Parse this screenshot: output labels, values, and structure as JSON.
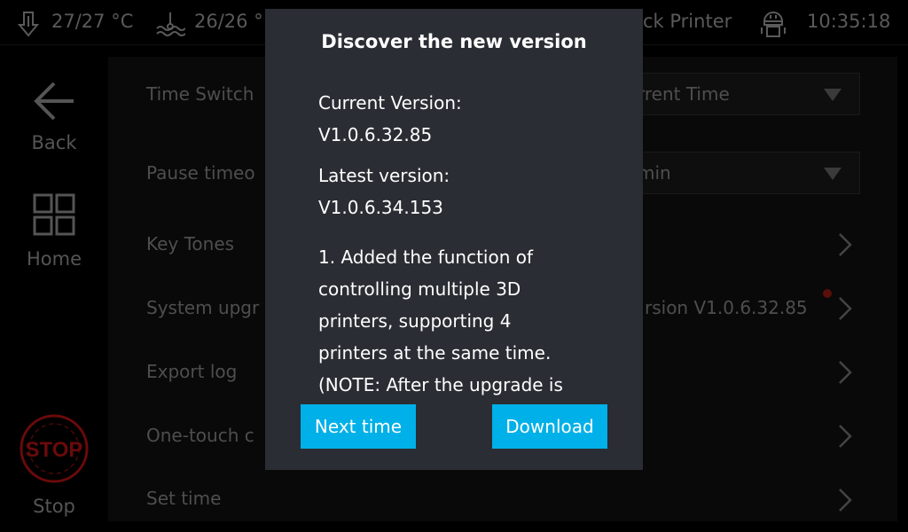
{
  "header": {
    "nozzle_temp": "27/27 °C",
    "bed_temp": "26/26 °",
    "printer_name": "ck Printer",
    "time": "10:35:18"
  },
  "sidebar": {
    "back": "Back",
    "home": "Home",
    "stop": "Stop",
    "stop_icon_text": "STOP"
  },
  "settings": {
    "rows": [
      {
        "label": "Time Switch",
        "value": "rrent Time",
        "type": "select"
      },
      {
        "label": "Pause timeo",
        "value": "min",
        "type": "select"
      },
      {
        "label": "Key Tones",
        "type": "link"
      },
      {
        "label": "System upgr",
        "value": "rsion V1.0.6.32.85",
        "type": "link",
        "badge": true
      },
      {
        "label": "Export log",
        "type": "link"
      },
      {
        "label": "One-touch c",
        "type": "link"
      },
      {
        "label": "Set time",
        "type": "link"
      }
    ]
  },
  "modal": {
    "title": "Discover the new version",
    "current_label": "Current Version:",
    "current_version": "V1.0.6.32.85",
    "latest_label": "Latest version:",
    "latest_version": "V1.0.6.34.153",
    "notes": [
      "1. Added the function of",
      "controlling multiple 3D",
      "printers, supporting 4",
      "printers at the same time.",
      "(NOTE: After the upgrade is"
    ],
    "next_time": "Next time",
    "download": "Download"
  },
  "colors": {
    "accent": "#00b0e8",
    "modal_bg": "#2a2d33",
    "badge": "#5a0f0a",
    "stop": "#6a0a0a"
  }
}
